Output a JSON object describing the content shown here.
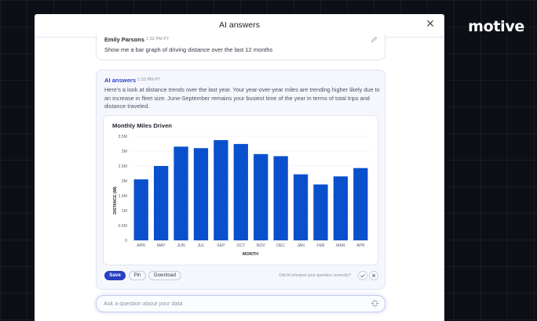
{
  "brand": {
    "logo_text": "motive"
  },
  "modal": {
    "title": "AI answers"
  },
  "user_message": {
    "name": "Emily Parsons",
    "time": "1:32 PM PT",
    "text": "Show me a bar graph of driving distance over the last 12 months"
  },
  "ai_message": {
    "name": "AI answers",
    "time": "1:33 PM PT",
    "text": "Here's a look at distance trends over the last year. Your year-over-year miles are trending higher likely due to an increase in fleet size. June-September remains your busiest time of the year in terms of total trips and distance traveled."
  },
  "actions": {
    "save": "Save",
    "pin": "Pin",
    "download": "Download",
    "feedback_question": "Did AI interpret your question correctly?"
  },
  "ask": {
    "placeholder": "Ask a question about your data"
  },
  "colors": {
    "accent": "#2a3fc4",
    "bar": "#0a50cc"
  },
  "icons": {
    "close": "close-icon",
    "edit": "pencil-icon",
    "sparkle": "sparkle-icon",
    "check": "check-icon",
    "dismiss": "x-icon"
  },
  "chart_data": {
    "type": "bar",
    "title": "Monthly Miles Driven",
    "xlabel": "MONTH",
    "ylabel": "DISTANCE (MI)",
    "categories": [
      "APR",
      "MAY",
      "JUN",
      "JUL",
      "SEP",
      "OCT",
      "NOV",
      "DEC",
      "JAN",
      "FEB",
      "MAR",
      "APR"
    ],
    "values": [
      2.05,
      2.5,
      3.15,
      3.1,
      3.37,
      3.24,
      2.9,
      2.83,
      2.22,
      1.88,
      2.15,
      2.43
    ],
    "ylim": [
      0,
      3.5
    ],
    "yticks": [
      0,
      0.5,
      1,
      1.5,
      2,
      2.5,
      3,
      3.5
    ],
    "yticklabels": [
      "0",
      "0.5M",
      "1M",
      "1.5M",
      "2M",
      "2.5M",
      "3M",
      "3.5M"
    ],
    "grid": true,
    "legend": "none"
  }
}
